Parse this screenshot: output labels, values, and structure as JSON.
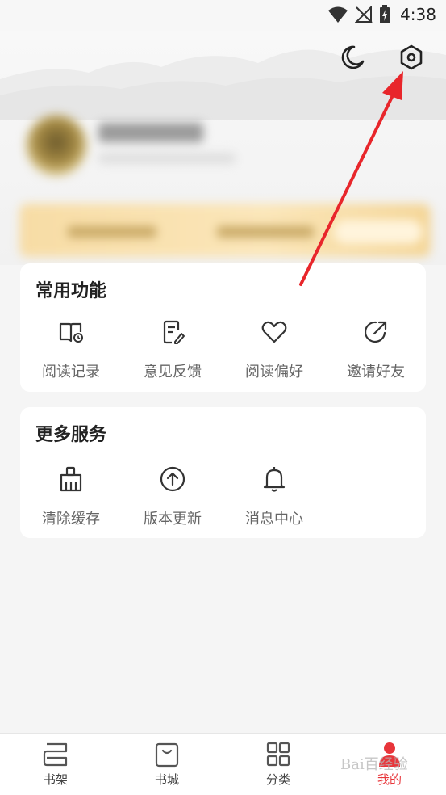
{
  "status": {
    "time": "4:38"
  },
  "header": {
    "night_icon": "moon-icon",
    "settings_icon": "settings-hexagon-icon"
  },
  "common": {
    "title": "常用功能",
    "items": [
      {
        "label": "阅读记录",
        "icon": "reading-history-icon"
      },
      {
        "label": "意见反馈",
        "icon": "feedback-icon"
      },
      {
        "label": "阅读偏好",
        "icon": "heart-icon"
      },
      {
        "label": "邀请好友",
        "icon": "invite-share-icon"
      }
    ]
  },
  "more": {
    "title": "更多服务",
    "items": [
      {
        "label": "清除缓存",
        "icon": "broom-icon"
      },
      {
        "label": "版本更新",
        "icon": "cloud-upload-icon"
      },
      {
        "label": "消息中心",
        "icon": "bell-icon"
      }
    ]
  },
  "tabs": [
    {
      "label": "书架",
      "icon": "bookshelf-icon"
    },
    {
      "label": "书城",
      "icon": "bookstore-bag-icon"
    },
    {
      "label": "分类",
      "icon": "category-grid-icon"
    },
    {
      "label": "我的",
      "icon": "profile-icon",
      "active": true
    }
  ],
  "watermark": "Bai百经验",
  "colors": {
    "accent": "#e8353a",
    "arrow": "#e8262b",
    "background": "#f5f5f5"
  }
}
